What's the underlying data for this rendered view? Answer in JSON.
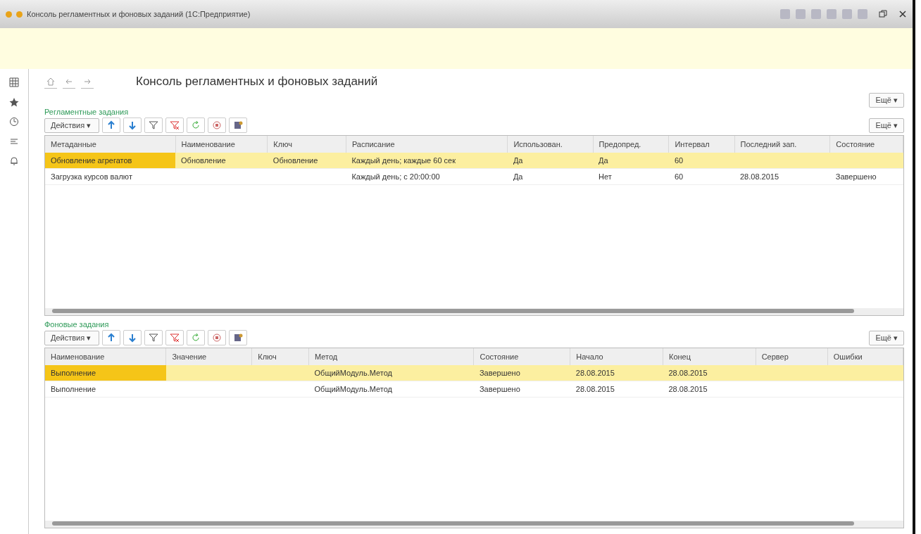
{
  "window": {
    "title": "Консоль регламентных и фоновых заданий (1С:Предприятие)"
  },
  "page": {
    "title": "Консоль регламентных и фоновых заданий",
    "more_button": "Ещё ▾"
  },
  "sections": [
    {
      "title": "Регламентные задания",
      "actions_button": "Действия ▾",
      "more_button": "Ещё ▾",
      "columns": [
        "Метаданные",
        "Наименование",
        "Ключ",
        "Расписание",
        "Использован.",
        "Предопред.",
        "Интервал",
        "Последний зап.",
        "Состояние"
      ],
      "rows": [
        {
          "selected": true,
          "cells": [
            "Обновление агрегатов",
            "Обновление",
            "Обновление",
            "Каждый день; каждые 60 сек",
            "Да",
            "Да",
            "60",
            "",
            ""
          ]
        },
        {
          "selected": false,
          "cells": [
            "Загрузка курсов валют",
            "",
            "",
            "Каждый день; с 20:00:00",
            "Да",
            "Нет",
            "60",
            "28.08.2015",
            "Завершено"
          ]
        }
      ]
    },
    {
      "title": "Фоновые задания",
      "actions_button": "Действия ▾",
      "more_button": "Ещё ▾",
      "columns": [
        "Наименование",
        "Значение",
        "Ключ",
        "Метод",
        "Состояние",
        "Начало",
        "Конец",
        "Сервер",
        "Ошибки"
      ],
      "rows": [
        {
          "selected": true,
          "cells": [
            "Выполнение",
            "",
            "",
            "ОбщийМодуль.Метод",
            "Завершено",
            "28.08.2015",
            "28.08.2015",
            "",
            ""
          ]
        },
        {
          "selected": false,
          "cells": [
            "Выполнение",
            "",
            "",
            "ОбщийМодуль.Метод",
            "Завершено",
            "28.08.2015",
            "28.08.2015",
            "",
            ""
          ]
        }
      ]
    }
  ]
}
